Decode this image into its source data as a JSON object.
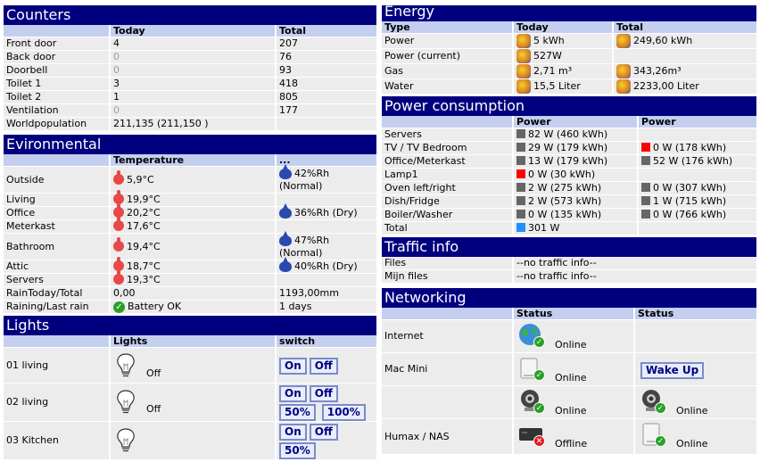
{
  "counters": {
    "title": "Counters",
    "headers": [
      "",
      "Today",
      "Total"
    ],
    "rows": [
      {
        "label": "Front door",
        "today": "4",
        "total": "207",
        "zero": false
      },
      {
        "label": "Back door",
        "today": "0",
        "total": "76",
        "zero": true
      },
      {
        "label": "Doorbell",
        "today": "0",
        "total": "93",
        "zero": true
      },
      {
        "label": "Toilet 1",
        "today": "3",
        "total": "418",
        "zero": false
      },
      {
        "label": "Toilet 2",
        "today": "1",
        "total": "805",
        "zero": false
      },
      {
        "label": "Ventilation",
        "today": "0",
        "total": "177",
        "zero": true
      },
      {
        "label": "Worldpopulation",
        "today": "211,135 (211,150 )",
        "total": "",
        "zero": false
      }
    ]
  },
  "environmental": {
    "title": "Evironmental",
    "headers": [
      "",
      "Temperature",
      "..."
    ],
    "rows": [
      {
        "label": "Outside",
        "temp": "5,9°C",
        "hum": "42%Rh",
        "hum2": "(Normal)"
      },
      {
        "label": "Living",
        "temp": "19,9°C",
        "hum": "",
        "hum2": ""
      },
      {
        "label": "Office",
        "temp": "20,2°C",
        "hum": "36%Rh (Dry)",
        "hum2": ""
      },
      {
        "label": "Meterkast",
        "temp": "17,6°C",
        "hum": "",
        "hum2": ""
      },
      {
        "label": "Bathroom",
        "temp": "19,4°C",
        "hum": "47%Rh",
        "hum2": "(Normal)"
      },
      {
        "label": "Attic",
        "temp": "18,7°C",
        "hum": "40%Rh (Dry)",
        "hum2": ""
      },
      {
        "label": "Servers",
        "temp": "19,3°C",
        "hum": "",
        "hum2": ""
      }
    ],
    "rain_label": "RainToday/Total",
    "rain_today": "0,00",
    "rain_total": "1193,00mm",
    "raining_label": "Raining/Last rain",
    "raining_status": "Battery OK",
    "last_rain": "1 days"
  },
  "lights": {
    "title": "Lights",
    "headers": [
      "",
      "Lights",
      "switch"
    ],
    "rows": [
      {
        "label": "01 living",
        "state": "Off",
        "buttons": [
          "On",
          "Off"
        ]
      },
      {
        "label": "02 living",
        "state": "Off",
        "buttons": [
          "On",
          "Off",
          "50%",
          "100%"
        ]
      },
      {
        "label": "03 Kitchen",
        "state": "",
        "buttons": [
          "On",
          "Off",
          "50%"
        ]
      }
    ]
  },
  "energy": {
    "title": "Energy",
    "headers": [
      "Type",
      "Today",
      "Total"
    ],
    "rows": [
      {
        "label": "Power",
        "today": "5 kWh",
        "total": "249,60 kWh"
      },
      {
        "label": "Power (current)",
        "today": "527W",
        "total": ""
      },
      {
        "label": "Gas",
        "today": "2,71 m³",
        "total": "343,26m³"
      },
      {
        "label": "Water",
        "today": "15,5 Liter",
        "total": "2233,00 Liter"
      }
    ]
  },
  "power": {
    "title": "Power consumption",
    "headers": [
      "",
      "Power",
      "Power"
    ],
    "rows": [
      {
        "label": "Servers",
        "p1": "82 W (460  kWh)",
        "c1": "#666666",
        "p2": "",
        "c2": ""
      },
      {
        "label": "TV / TV Bedroom",
        "p1": "29 W (179  kWh)",
        "c1": "#666666",
        "p2": "0 W (178 kWh)",
        "c2": "#ff0000"
      },
      {
        "label": "Office/Meterkast",
        "p1": "13 W (179 kWh)",
        "c1": "#666666",
        "p2": "52 W (176  kWh)",
        "c2": "#666666"
      },
      {
        "label": "Lamp1",
        "p1": "0 W (30 kWh)",
        "c1": "#ff0000",
        "p2": "",
        "c2": ""
      },
      {
        "label": "Oven left/right",
        "p1": "2 W (275 kWh)",
        "c1": "#666666",
        "p2": "0 W (307 kWh)",
        "c2": "#666666"
      },
      {
        "label": "Dish/Fridge",
        "p1": "2 W (573 kWh)",
        "c1": "#666666",
        "p2": "1 W (715 kWh)",
        "c2": "#666666"
      },
      {
        "label": "Boiler/Washer",
        "p1": "0 W (135  kWh)",
        "c1": "#666666",
        "p2": "0 W (766 kWh)",
        "c2": "#666666"
      },
      {
        "label": "Total",
        "p1": "301 W",
        "c1": "#2090ff",
        "p2": "",
        "c2": ""
      }
    ]
  },
  "traffic": {
    "title": "Traffic info",
    "rows": [
      {
        "label": "Files",
        "value": "--no traffic info--"
      },
      {
        "label": "Mijn files",
        "value": "--no traffic info--"
      }
    ]
  },
  "networking": {
    "title": "Networking",
    "headers": [
      "",
      "Status",
      "Status"
    ],
    "rows": [
      {
        "label": "Internet",
        "s1": "Online",
        "i1": "globe-icon",
        "s2": "",
        "i2": ""
      },
      {
        "label": "Mac Mini",
        "s1": "Online",
        "i1": "computer-icon",
        "s2": "",
        "i2": "",
        "wake": "Wake Up"
      },
      {
        "label": "",
        "s1": "Online",
        "i1": "webcam-icon",
        "s2": "Online",
        "i2": "webcam-icon"
      },
      {
        "label": "Humax / NAS",
        "s1": "Offline",
        "i1": "receiver-icon",
        "s2": "Online",
        "i2": "nas-icon"
      }
    ]
  }
}
